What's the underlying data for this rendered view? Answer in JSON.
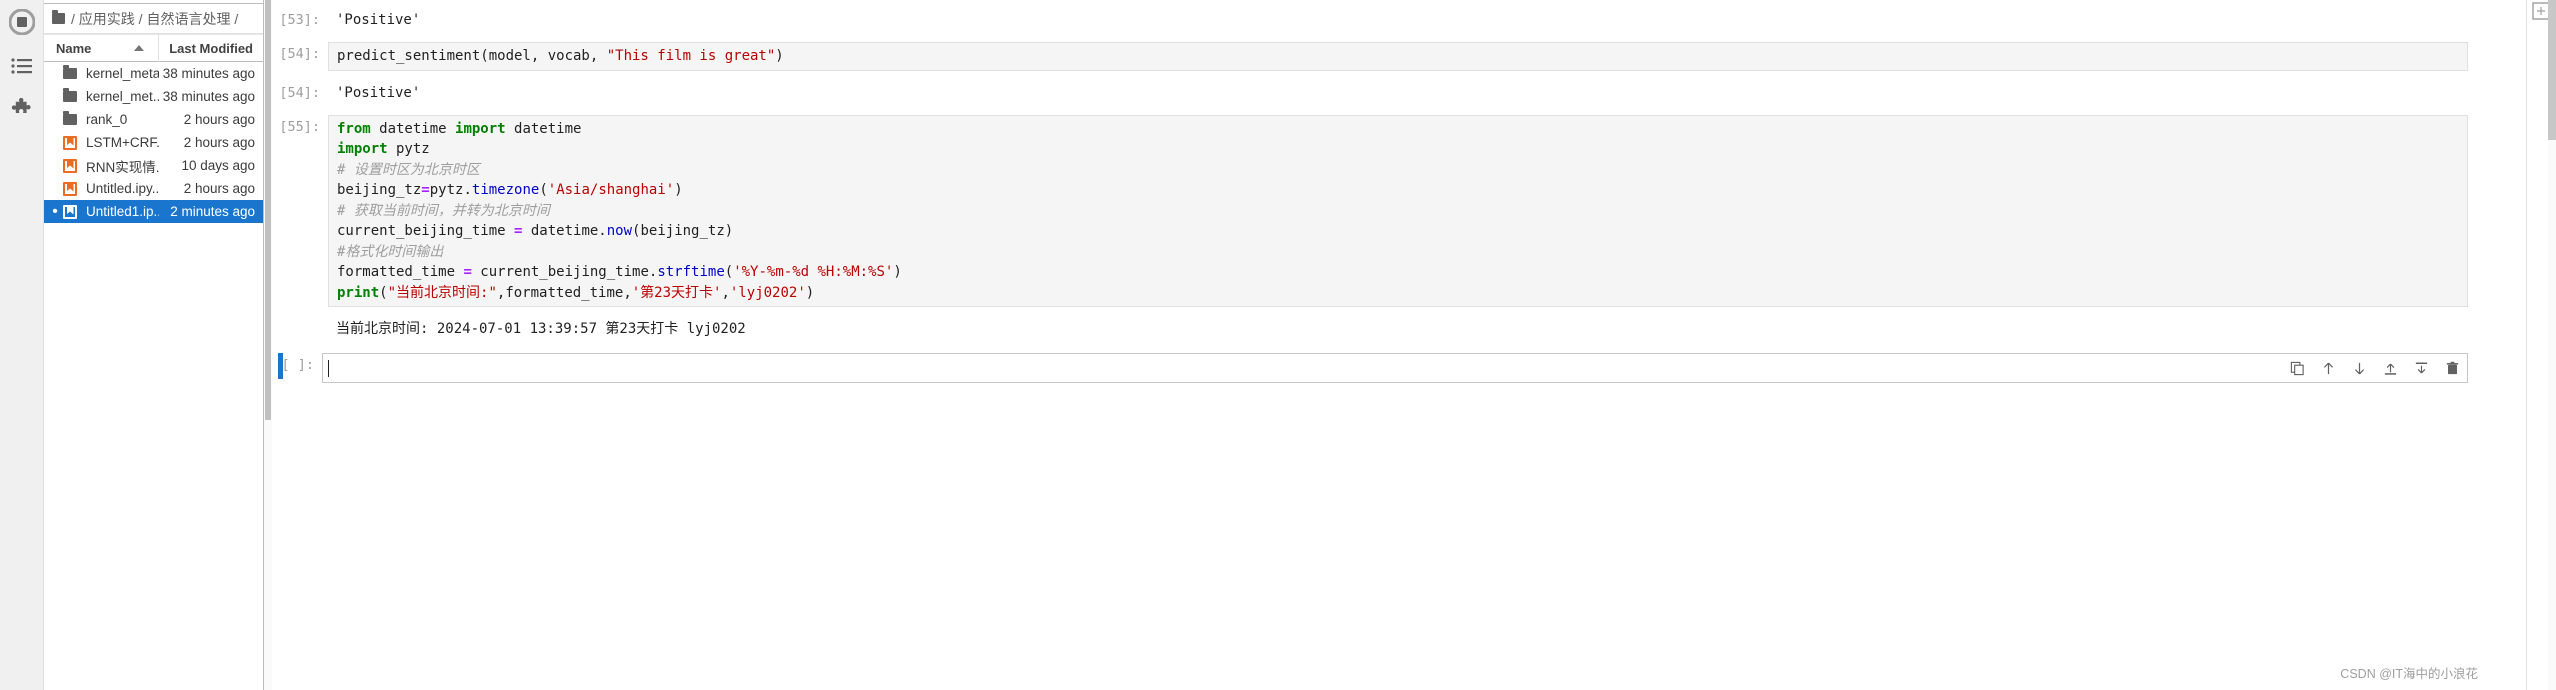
{
  "activity_bar": {
    "items": [
      {
        "name": "jupyter-logo-icon",
        "label": ""
      },
      {
        "name": "file-browser-icon",
        "label": ""
      },
      {
        "name": "extension-manager-icon",
        "label": ""
      }
    ]
  },
  "file_browser": {
    "breadcrumb": "/ 应用实践 / 自然语言处理 /",
    "columns": {
      "name": "Name",
      "last_modified": "Last Modified"
    },
    "rows": [
      {
        "name": "kernel_meta",
        "modified": "38 minutes ago",
        "kind": "folder",
        "selected": false,
        "running": false
      },
      {
        "name": "kernel_met...",
        "modified": "38 minutes ago",
        "kind": "folder",
        "selected": false,
        "running": false
      },
      {
        "name": "rank_0",
        "modified": "2 hours ago",
        "kind": "folder",
        "selected": false,
        "running": false
      },
      {
        "name": "LSTM+CRF...",
        "modified": "2 hours ago",
        "kind": "notebook",
        "selected": false,
        "running": false
      },
      {
        "name": "RNN实现情...",
        "modified": "10 days ago",
        "kind": "notebook",
        "selected": false,
        "running": false
      },
      {
        "name": "Untitled.ipy...",
        "modified": "2 hours ago",
        "kind": "notebook",
        "selected": false,
        "running": false
      },
      {
        "name": "Untitled1.ip...",
        "modified": "2 minutes ago",
        "kind": "notebook",
        "selected": true,
        "running": true
      }
    ]
  },
  "notebook": {
    "cells": [
      {
        "type": "output",
        "prompt": "[53]:",
        "text": "'Positive'"
      },
      {
        "type": "code",
        "prompt": "[54]:",
        "text": "predict_sentiment(model, vocab, \"This film is great\")"
      },
      {
        "type": "output",
        "prompt": "[54]:",
        "text": "'Positive'"
      },
      {
        "type": "code",
        "prompt": "[55]:",
        "lines": [
          "from datetime import datetime",
          "import pytz",
          "# 设置时区为北京时区",
          "beijing_tz=pytz.timezone('Asia/shanghai')",
          "# 获取当前时间，并转为北京时间",
          "current_beijing_time = datetime.now(beijing_tz)",
          "#格式化时间输出",
          "formatted_time = current_beijing_time.strftime('%Y-%m-%d %H:%M:%S')",
          "print(\"当前北京时间:\",formatted_time,'第23天打卡','lyj0202')"
        ]
      },
      {
        "type": "stream-output",
        "prompt": "",
        "text": "当前北京时间: 2024-07-01 13:39:57 第23天打卡 lyj0202"
      }
    ],
    "active_cell": {
      "prompt": "[ ]:",
      "value": "",
      "placeholder": ""
    },
    "cell_toolbar": [
      {
        "name": "duplicate-cell-icon",
        "title": "Duplicate"
      },
      {
        "name": "move-cell-up-icon",
        "title": "Move up"
      },
      {
        "name": "move-cell-down-icon",
        "title": "Move down"
      },
      {
        "name": "insert-cell-above-icon",
        "title": "Insert above"
      },
      {
        "name": "insert-cell-below-icon",
        "title": "Insert below"
      },
      {
        "name": "delete-cell-icon",
        "title": "Delete"
      }
    ]
  },
  "watermark": "CSDN @IT海中的小浪花",
  "colors": {
    "selection": "#1a75cf",
    "notebook_icon": "#ee6c21",
    "code_bg": "#f5f5f5",
    "keyword": "#008000",
    "string": "#bb0000",
    "comment": "#9e9e9e",
    "operator": "#aa22ff",
    "builtin": "#0000cd"
  }
}
